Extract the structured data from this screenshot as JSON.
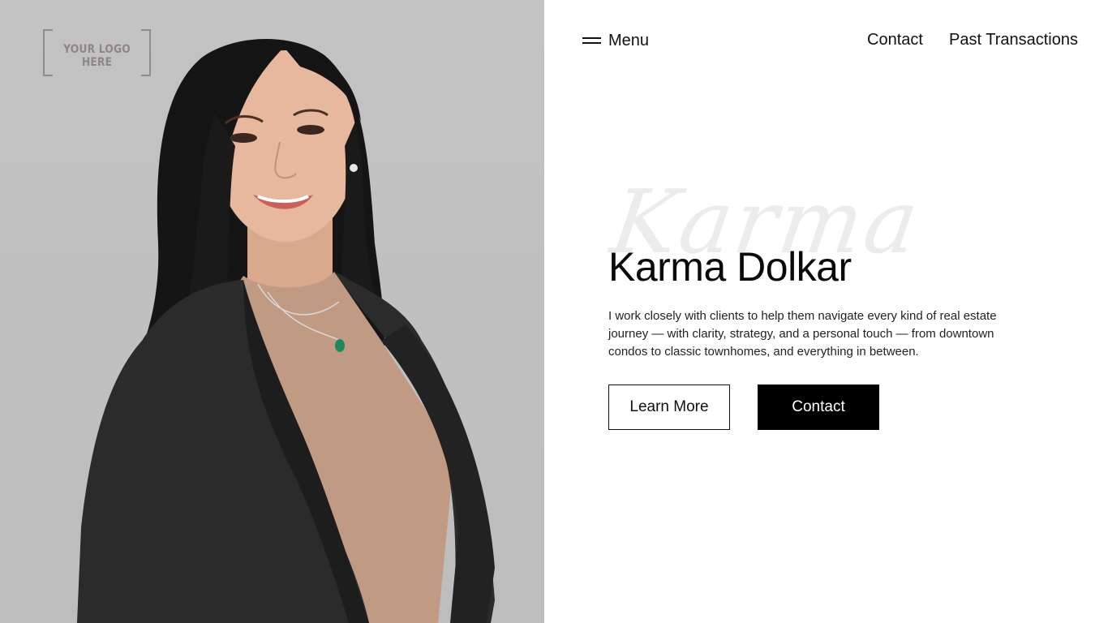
{
  "logo": {
    "text": "YOUR LOGO HERE"
  },
  "header": {
    "menu_label": "Menu",
    "nav": {
      "contact": "Contact",
      "past_transactions": "Past Transactions"
    }
  },
  "hero": {
    "script_text": "Karma",
    "name": "Karma Dolkar",
    "description": "I work closely with clients to help them navigate every kind of real estate journey — with clarity, strategy, and a personal touch — from downtown condos to classic townhomes, and everything in between.",
    "learn_more_label": "Learn More",
    "contact_label": "Contact"
  },
  "colors": {
    "photo_background": "#bfbfbf",
    "primary_button": "#000000",
    "script_watermark": "#ececec"
  },
  "icons": {
    "menu": "hamburger-menu-icon"
  }
}
